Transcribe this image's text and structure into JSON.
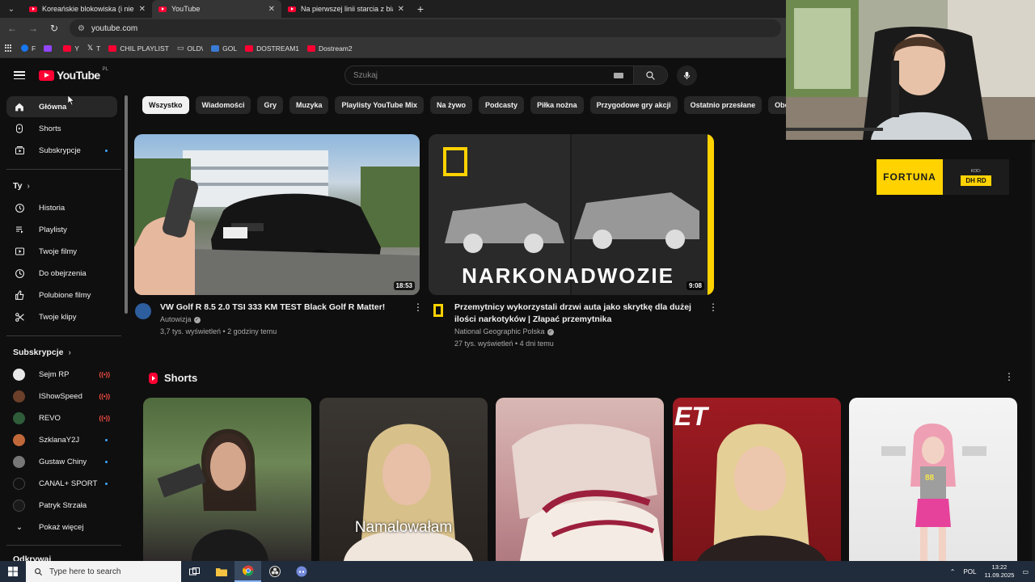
{
  "browser": {
    "tabs": [
      {
        "title": "Koreańskie blokowiska (i nie tylko)",
        "active": false
      },
      {
        "title": "YouTube",
        "active": true
      },
      {
        "title": "Na pierwszej linii starcia z białoruskim",
        "active": false
      }
    ],
    "new_tab": "+",
    "url": "youtube.com",
    "bookmarks": [
      {
        "label": "F",
        "color": "#1877f2"
      },
      {
        "label": "",
        "color": "#9146ff"
      },
      {
        "label": "Y",
        "color": "#ff0033"
      },
      {
        "label": "T",
        "color": "#222222"
      },
      {
        "label": "CHIL PLAYLIST",
        "color": "#ff0033"
      },
      {
        "label": "OLD\\",
        "color": "#888888"
      },
      {
        "label": "GOL",
        "color": "#3a7bd5"
      },
      {
        "label": "DOSTREAM1",
        "color": "#ff0033"
      },
      {
        "label": "Dostream2",
        "color": "#ff0033"
      }
    ]
  },
  "header": {
    "logo_word": "YouTube",
    "country": "PL",
    "search_placeholder": "Szukaj"
  },
  "sidebar": {
    "main": [
      {
        "label": "Główna",
        "icon": "home-icon",
        "active": true
      },
      {
        "label": "Shorts",
        "icon": "shorts-icon"
      },
      {
        "label": "Subskrypcje",
        "icon": "subscriptions-icon",
        "dot": true
      }
    ],
    "you_heading": "Ty",
    "you": [
      {
        "label": "Historia",
        "icon": "history-icon"
      },
      {
        "label": "Playlisty",
        "icon": "playlists-icon"
      },
      {
        "label": "Twoje filmy",
        "icon": "your-videos-icon"
      },
      {
        "label": "Do obejrzenia",
        "icon": "watch-later-icon"
      },
      {
        "label": "Polubione filmy",
        "icon": "liked-icon"
      },
      {
        "label": "Twoje klipy",
        "icon": "clips-icon"
      }
    ],
    "subs_heading": "Subskrypcje",
    "subs": [
      {
        "label": "Sejm RP",
        "live": true,
        "color": "#e8e8e8"
      },
      {
        "label": "IShowSpeed",
        "live": true,
        "color": "#6b3f2a"
      },
      {
        "label": "REVO",
        "live": true,
        "color": "#2f5d3a"
      },
      {
        "label": "SzklanaY2J",
        "dot": true,
        "color": "#c0683a"
      },
      {
        "label": "Gustaw Chiny",
        "dot": true,
        "color": "#777777"
      },
      {
        "label": "CANAL+ SPORT",
        "dot": true,
        "color": "#111111"
      },
      {
        "label": "Patryk Strzała",
        "color": "#1a1a1a"
      }
    ],
    "show_more": "Pokaż więcej",
    "explore_heading": "Odkrywaj"
  },
  "chips": [
    "Wszystko",
    "Wiadomości",
    "Gry",
    "Muzyka",
    "Playlisty YouTube Mix",
    "Na żywo",
    "Podcasty",
    "Piłka nożna",
    "Przygodowe gry akcji",
    "Ostatnio przesłane",
    "Obejrzane"
  ],
  "videos": [
    {
      "title": "VW Golf R 8.5 2.0 TSI 333 KM TEST Black Golf R Matter!",
      "channel": "Autowizja",
      "meta": "3,7 tys. wyświetleń • 2 godziny temu",
      "duration": "18:53",
      "verified": true
    },
    {
      "title_line1": "Przemytnicy wykorzystali drzwi auta jako skrytkę dla dużej",
      "title_line2": "ilości narkotyków | Złapać przemytnika",
      "channel": "National Geographic Polska",
      "meta": "27 tys. wyświetleń • 4 dni temu",
      "duration": "9:08",
      "overlay": "NARKONADWOZIE",
      "verified": true
    }
  ],
  "ad": {
    "brand": "FORTUNA",
    "kod": "KOD:",
    "code": "DH RD"
  },
  "shorts": {
    "heading": "Shorts",
    "items": [
      {
        "overlay": ""
      },
      {
        "overlay": "Namalowałam"
      },
      {
        "overlay": ""
      },
      {
        "overlay": "ET"
      },
      {
        "overlay": "88"
      }
    ]
  },
  "taskbar": {
    "search_placeholder": "Type here to search",
    "lang": "POL",
    "time": "13:22",
    "date": "11.09.2025"
  }
}
